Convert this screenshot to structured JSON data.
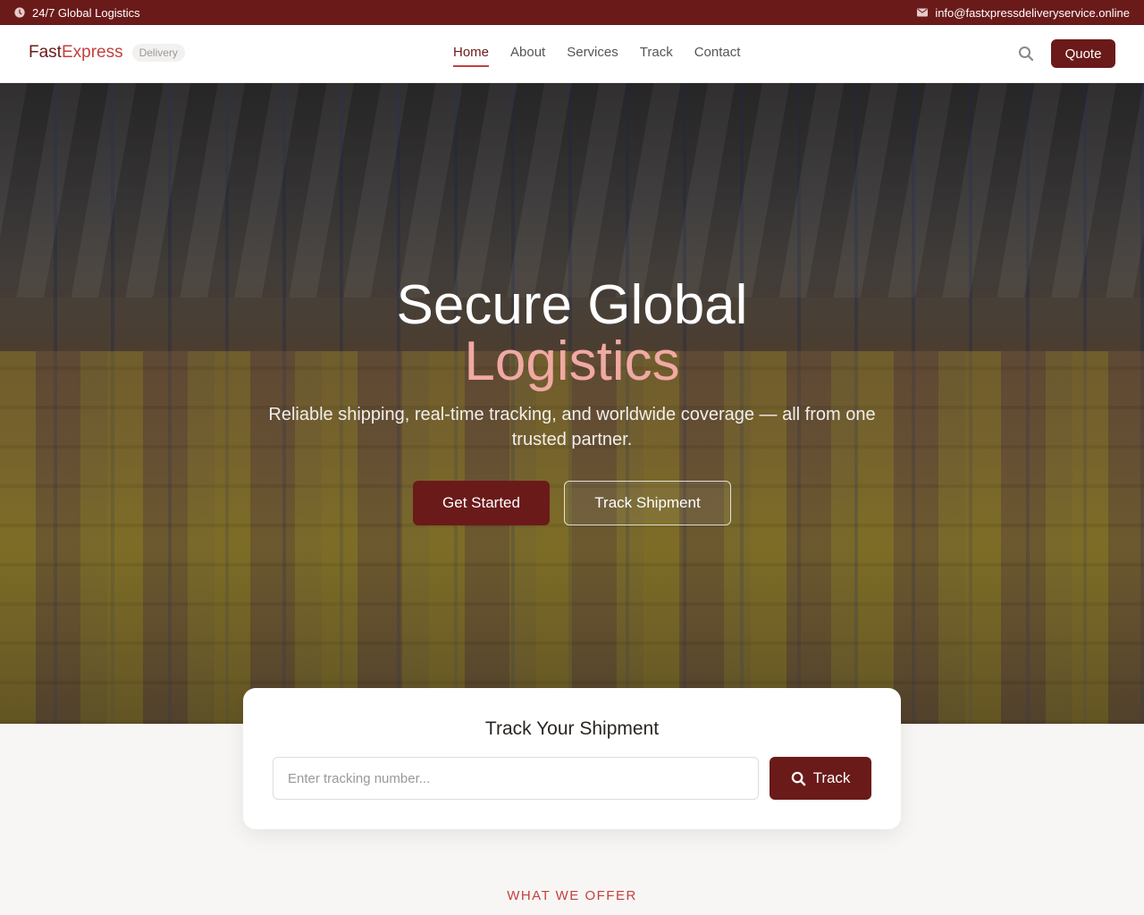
{
  "topbar": {
    "left_text": "24/7 Global Logistics",
    "right_text": "info@fastxpressdeliveryservice.online",
    "left_icon": "clock-icon",
    "right_icon": "mail-icon"
  },
  "brand": {
    "name_part1": "Fast",
    "name_part2": "Express",
    "badge": "Delivery"
  },
  "nav": {
    "items": [
      {
        "label": "Home",
        "active": true
      },
      {
        "label": "About",
        "active": false
      },
      {
        "label": "Services",
        "active": false
      },
      {
        "label": "Track",
        "active": false
      },
      {
        "label": "Contact",
        "active": false
      }
    ],
    "quote_label": "Quote",
    "search_icon": "search-icon"
  },
  "hero": {
    "title_line1": "Secure Global",
    "title_line2": "Logistics",
    "subtitle": "Reliable shipping, real-time tracking, and worldwide coverage — all from one trusted partner.",
    "primary_cta": "Get Started",
    "secondary_cta": "Track Shipment"
  },
  "tracking": {
    "title": "Track Your Shipment",
    "placeholder": "Enter tracking number...",
    "value": "",
    "button_label": "Track"
  },
  "section": {
    "eyebrow": "WHAT WE OFFER"
  },
  "colors": {
    "brand_dark": "#6b1a1a",
    "brand_accent": "#c2413f",
    "hero_highlight": "#f0a9a3"
  }
}
